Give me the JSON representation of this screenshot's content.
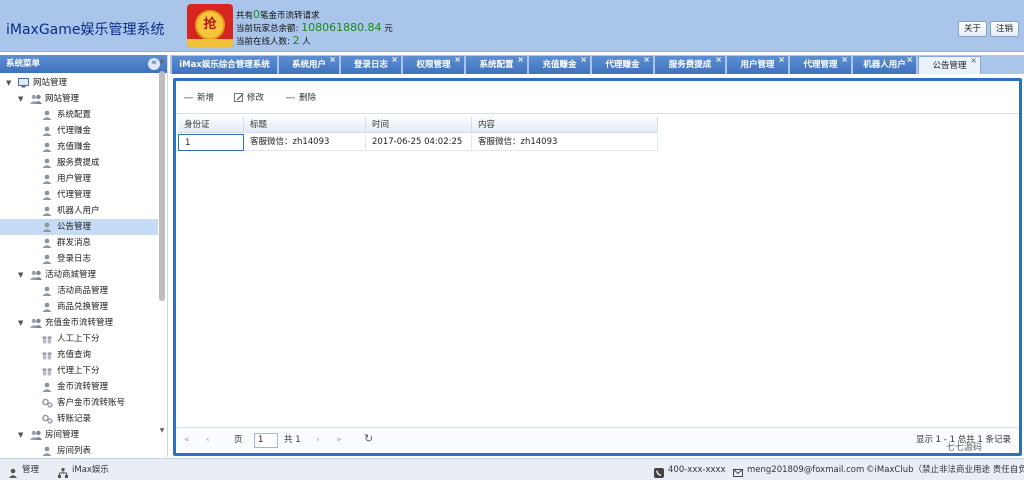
{
  "header": {
    "title": "iMaxGame娱乐管理系统",
    "logo_char": "抢",
    "line1_prefix": "共有",
    "pending_count": "0",
    "line1_suffix": "笔金币流转请求",
    "line2_prefix": "当前玩家总余额:",
    "total_balance": "108061880.84",
    "line2_suffix": "元",
    "line3_prefix": "当前在线人数:",
    "online_count": "2",
    "line3_suffix": "人",
    "about_label": "关于",
    "logout_label": "注销"
  },
  "sidebar": {
    "title": "系统菜单",
    "collapse_glyph": "«",
    "items": [
      {
        "label": "网站管理",
        "level": 0,
        "icon": "monitor-icon",
        "toggle": "▼"
      },
      {
        "label": "网站管理",
        "level": 1,
        "icon": "users-group-icon",
        "toggle": "▼"
      },
      {
        "label": "系统配置",
        "level": 2,
        "icon": "user-icon"
      },
      {
        "label": "代理赚金",
        "level": 2,
        "icon": "user-icon"
      },
      {
        "label": "充值赚金",
        "level": 2,
        "icon": "user-icon"
      },
      {
        "label": "服务费提成",
        "level": 2,
        "icon": "user-icon"
      },
      {
        "label": "用户管理",
        "level": 2,
        "icon": "user-icon"
      },
      {
        "label": "代理管理",
        "level": 2,
        "icon": "user-icon"
      },
      {
        "label": "机器人用户",
        "level": 2,
        "icon": "user-icon"
      },
      {
        "label": "公告管理",
        "level": 2,
        "icon": "user-icon",
        "selected": true
      },
      {
        "label": "群发消息",
        "level": 2,
        "icon": "user-icon"
      },
      {
        "label": "登录日志",
        "level": 2,
        "icon": "user-icon"
      },
      {
        "label": "活动商城管理",
        "level": 1,
        "icon": "users-group-icon",
        "toggle": "▼"
      },
      {
        "label": "活动商品管理",
        "level": 2,
        "icon": "user-icon"
      },
      {
        "label": "商品兑换管理",
        "level": 2,
        "icon": "user-icon"
      },
      {
        "label": "充值金币流转管理",
        "level": 1,
        "icon": "users-group-icon",
        "toggle": "▼"
      },
      {
        "label": "人工上下分",
        "level": 2,
        "icon": "gift-icon"
      },
      {
        "label": "充值查询",
        "level": 2,
        "icon": "gift-icon"
      },
      {
        "label": "代理上下分",
        "level": 2,
        "icon": "gift-icon"
      },
      {
        "label": "金币流转管理",
        "level": 2,
        "icon": "user-icon"
      },
      {
        "label": "客户金币流转账号",
        "level": 2,
        "icon": "gears-icon"
      },
      {
        "label": "转账记录",
        "level": 2,
        "icon": "gears-icon"
      },
      {
        "label": "房间管理",
        "level": 1,
        "icon": "users-group-icon",
        "toggle": "▼"
      },
      {
        "label": "房间列表",
        "level": 2,
        "icon": "user-icon"
      }
    ]
  },
  "tabs": [
    {
      "label": "iMax娱乐综合管理系统",
      "closable": false
    },
    {
      "label": "系统用户",
      "closable": true
    },
    {
      "label": "登录日志",
      "closable": true
    },
    {
      "label": "权限管理",
      "closable": true
    },
    {
      "label": "系统配置",
      "closable": true
    },
    {
      "label": "充值赚金",
      "closable": true
    },
    {
      "label": "代理赚金",
      "closable": true
    },
    {
      "label": "服务费提成",
      "closable": true
    },
    {
      "label": "用户管理",
      "closable": true
    },
    {
      "label": "代理管理",
      "closable": true
    },
    {
      "label": "机器人用户",
      "closable": true
    },
    {
      "label": "公告管理",
      "closable": true,
      "active": true
    }
  ],
  "toolbar": {
    "add_label": "新增",
    "edit_label": "修改",
    "delete_label": "删除"
  },
  "grid": {
    "columns": [
      "身份证",
      "标题",
      "时间",
      "内容"
    ],
    "rows": [
      [
        "1",
        "客服微信：zh14093",
        "2017-06-25 04:02:25",
        "客服微信：zh14093"
      ]
    ]
  },
  "pager": {
    "first": "«",
    "prev": "‹",
    "page_label": "页",
    "page_value": "1",
    "of_label": "共 1",
    "next": "›",
    "last": "»",
    "refresh": "↻",
    "info": "显示 1 - 1 总共 1 条记录"
  },
  "footer": {
    "user_label": "管理",
    "org_label": "iMax娱乐",
    "phone": "400-xxx-xxxx",
    "email": "meng201809@foxmail.com",
    "copyright": "©iMaxClub（禁止非法商业用途 责任自负）"
  },
  "watermark": "七七源码",
  "colors": {
    "header_bg": "#a9c6ea",
    "tab_bg": "#3e72bd",
    "accent": "#2e6fc6",
    "selected_row": "#c6dcf6",
    "balance_green": "#1b8a1b"
  }
}
